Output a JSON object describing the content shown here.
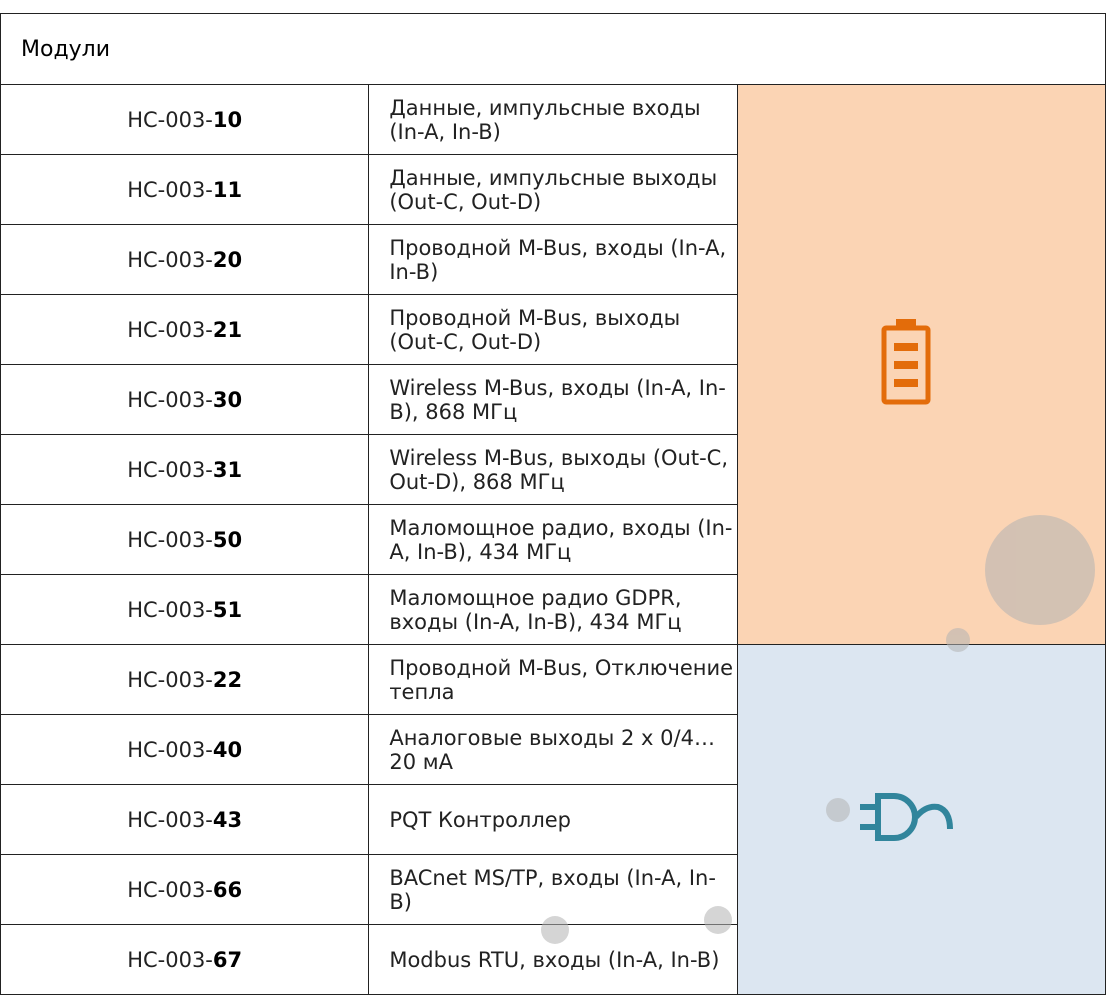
{
  "table": {
    "header": "Модули",
    "prefix": "HC-003-",
    "battery_group": {
      "icon": "battery-icon",
      "color": "#fbd4b4",
      "icon_color": "#e36c0a",
      "rows": [
        {
          "suffix": "10",
          "description": "Данные, импульсные входы (In-A, In-B)"
        },
        {
          "suffix": "11",
          "description": "Данные, импульсные выходы (Out-C, Out-D)"
        },
        {
          "suffix": "20",
          "description": "Проводной M-Bus, входы (In-A, In-B)"
        },
        {
          "suffix": "21",
          "description": "Проводной M-Bus, выходы (Out-C, Out-D)"
        },
        {
          "suffix": "30",
          "description": "Wireless M-Bus, входы (In-A, In-B), 868 МГц"
        },
        {
          "suffix": "31",
          "description": "Wireless M-Bus, выходы (Out-C, Out-D), 868 МГц"
        },
        {
          "suffix": "50",
          "description": "Маломощное радио, входы (In-A, In-B), 434 МГц"
        },
        {
          "suffix": "51",
          "description": "Маломощное радио GDPR, входы (In-A, In-B), 434 МГц"
        }
      ]
    },
    "wired_group": {
      "icon": "power-plug-icon",
      "color": "#dce6f1",
      "icon_color": "#31859c",
      "rows": [
        {
          "suffix": "22",
          "description": "Проводной M-Bus, Отключение тепла"
        },
        {
          "suffix": "40",
          "description": "Аналоговые выходы 2 x 0/4…20 мА"
        },
        {
          "suffix": "43",
          "description": "PQT Контроллер"
        },
        {
          "suffix": "66",
          "description": "BACnet MS/TP, входы (In-A, In-B)"
        },
        {
          "suffix": "67",
          "description": "Modbus RTU, входы (In-A, In-B)"
        }
      ]
    }
  }
}
